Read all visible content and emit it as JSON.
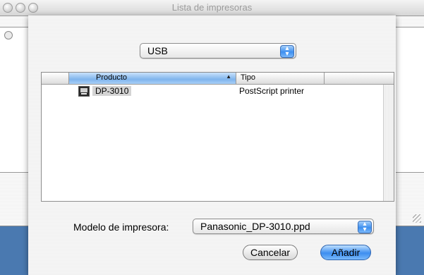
{
  "window": {
    "title": "Lista de impresoras"
  },
  "connection": {
    "selected": "USB"
  },
  "printer_list": {
    "columns": [
      "Producto",
      "Tipo"
    ],
    "rows": [
      {
        "product": "DP-3010",
        "type": "PostScript printer"
      }
    ]
  },
  "model": {
    "label": "Modelo de impresora:",
    "selected": "Panasonic_DP-3010.ppd"
  },
  "buttons": {
    "cancel": "Cancelar",
    "add": "Añadir"
  },
  "colors": {
    "accent": "#3d8ef0",
    "background": "#4a79b0"
  }
}
